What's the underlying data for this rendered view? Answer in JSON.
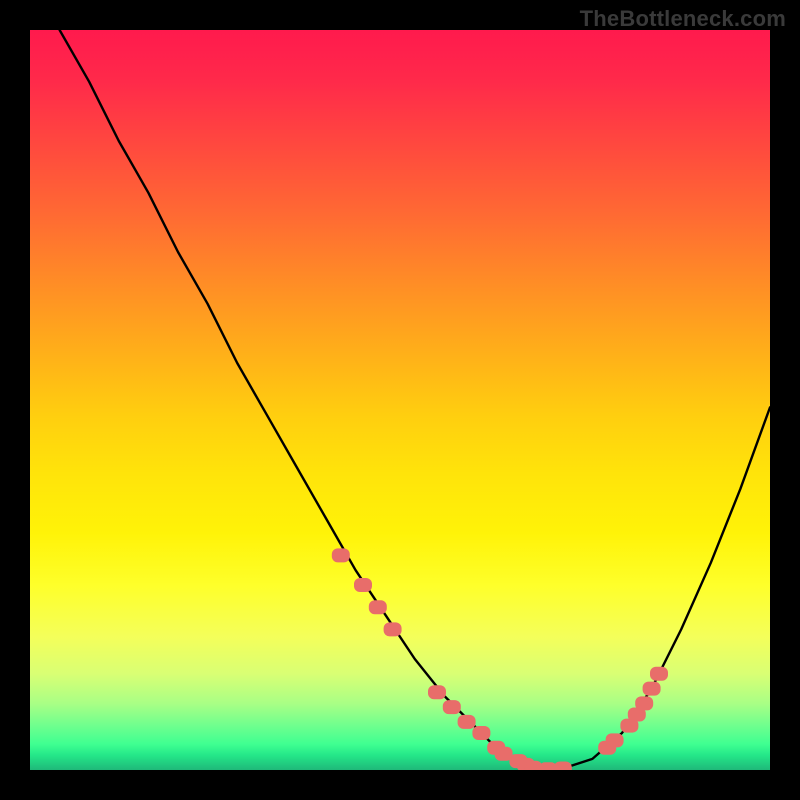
{
  "watermark": "TheBottleneck.com",
  "colors": {
    "curve": "#000000",
    "marker": "#e86d6a",
    "bg_top": "#ff1a4d",
    "bg_bottom": "#1fb879"
  },
  "chart_data": {
    "type": "line",
    "title": "",
    "xlabel": "",
    "ylabel": "",
    "xlim": [
      0,
      100
    ],
    "ylim": [
      0,
      100
    ],
    "grid": false,
    "legend": false,
    "annotations": [
      "TheBottleneck.com"
    ],
    "series": [
      {
        "name": "bottleneck-curve",
        "x": [
          4,
          8,
          12,
          16,
          20,
          24,
          28,
          32,
          36,
          40,
          44,
          48,
          52,
          56,
          60,
          63,
          66,
          69,
          72,
          76,
          80,
          84,
          88,
          92,
          96,
          100
        ],
        "y": [
          100,
          93,
          85,
          78,
          70,
          63,
          55,
          48,
          41,
          34,
          27,
          21,
          15,
          10,
          6,
          3,
          1,
          0,
          0.2,
          1.5,
          5,
          11,
          19,
          28,
          38,
          49
        ]
      }
    ],
    "markers": {
      "name": "highlighted-points",
      "x": [
        42,
        45,
        47,
        49,
        55,
        57,
        59,
        61,
        63,
        64,
        66,
        67,
        68,
        70,
        72,
        78,
        79,
        81,
        82,
        83,
        84,
        85
      ],
      "y": [
        29,
        25,
        22,
        19,
        10.5,
        8.5,
        6.5,
        5,
        3,
        2.2,
        1.2,
        0.7,
        0.3,
        0.1,
        0.2,
        3,
        4,
        6,
        7.5,
        9,
        11,
        13
      ]
    }
  }
}
